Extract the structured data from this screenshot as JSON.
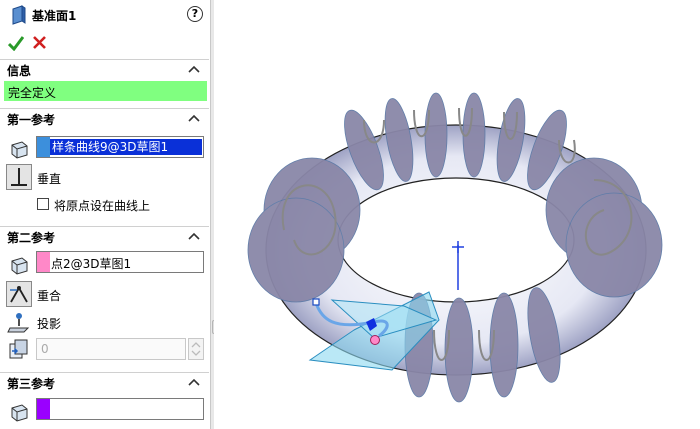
{
  "panel": {
    "title": "基准面1",
    "help": "?",
    "sections": {
      "info": {
        "label": "信息",
        "status": "完全定义"
      },
      "first_ref": {
        "label": "第一参考",
        "selection": "样条曲线9@3D草图1",
        "swatch_color": "#3c8fdc",
        "option": "垂直",
        "checkbox_label": "将原点设在曲线上"
      },
      "second_ref": {
        "label": "第二参考",
        "selection": "点2@3D草图1",
        "swatch_color": "#ff88c8",
        "options": [
          "重合",
          "投影"
        ],
        "count_value": "0"
      },
      "third_ref": {
        "label": "第三参考",
        "selection": "",
        "swatch_color": "#9a00ff"
      }
    }
  },
  "colors": {
    "info_bar": "#80ff80",
    "selection_highlight": "#0a30d8",
    "plane_fill": "#8cd8f0",
    "coil_fill": "#8a87a8"
  }
}
